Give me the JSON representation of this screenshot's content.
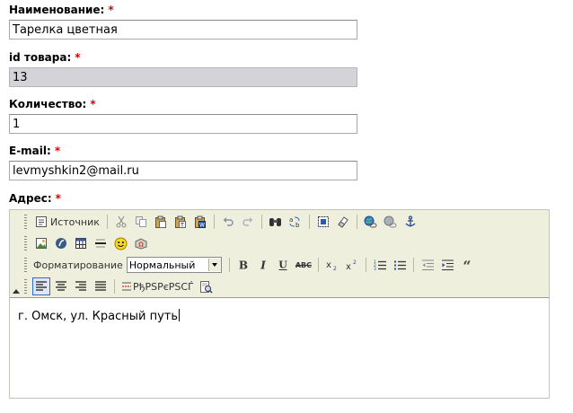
{
  "fields": {
    "name": {
      "label": "Наименование:",
      "value": "Тарелка цветная"
    },
    "product_id": {
      "label": "id товара:",
      "value": "13"
    },
    "quantity": {
      "label": "Количество:",
      "value": "1"
    },
    "email": {
      "label": "E-mail:",
      "value": "levmyshkin2@mail.ru"
    },
    "address": {
      "label": "Адрес:"
    },
    "required_mark": "*"
  },
  "editor": {
    "source_label": "Источник",
    "format_label": "Форматирование",
    "format_value": "Нормальный",
    "strike_label": "ABC",
    "encoded_label": "PђPSPєPSCЃ",
    "content": "г. Омск, ул. Красный путь"
  },
  "colors": {
    "required": "#e00000",
    "toolbar_bg": "#efefde",
    "readonly_bg": "#d4d4d8",
    "active_border": "#316ac5"
  }
}
